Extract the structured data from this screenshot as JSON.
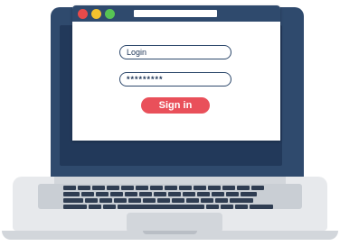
{
  "login_form": {
    "login_value": "Login",
    "password_value": "*********",
    "signin_label": "Sign in"
  },
  "browser": {
    "controls": [
      "close",
      "minimize",
      "maximize"
    ],
    "colors": {
      "close": "#e84a4a",
      "minimize": "#f2c12e",
      "maximize": "#57c454",
      "titlebar": "#2f4a6d"
    }
  },
  "colors": {
    "accent": "#e9505a",
    "laptop_body": "#2f4a6d",
    "base": "#e7e9ec",
    "keys": "#2f3d52"
  },
  "icons": [
    "laptop-illustration",
    "keyboard-icon",
    "touchpad-icon"
  ]
}
